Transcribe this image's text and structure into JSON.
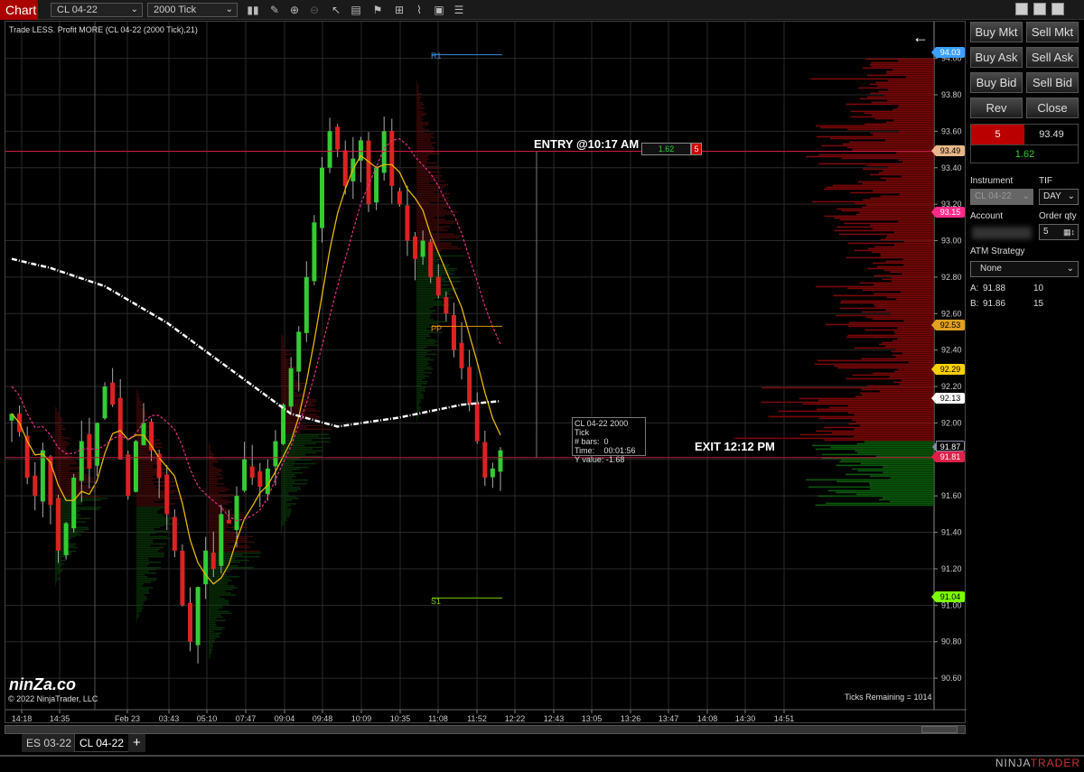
{
  "window": {
    "title": "Chart",
    "instrument": "CL 04-22",
    "interval": "2000 Tick"
  },
  "toolbar_icons": [
    "bar-type-icon",
    "draw-pencil-icon",
    "zoom-in-icon",
    "zoom-out-icon",
    "pointer-icon",
    "data-box-icon",
    "strategies-icon",
    "indicators-icon",
    "drawing-tools-icon",
    "templates-icon",
    "properties-icon"
  ],
  "chart": {
    "indicator_label": "Trade LESS. Profit MORE (CL 04-22 (2000 Tick),21)",
    "entry_label": "ENTRY @10:17 AM",
    "exit_label": "EXIT 12:12 PM",
    "position_pnl": "1.62",
    "position_qty": "5",
    "level_labels": {
      "r1": "R1",
      "pp": "PP",
      "s1": "S1"
    },
    "tooltip": {
      "line1": "CL 04-22 2000 Tick",
      "bars_label": "# bars:",
      "bars": "0",
      "time_label": "Time:",
      "time": "00:01:56",
      "y_label": "Y value:",
      "y": "-1.68"
    },
    "logo": "ninZa.co",
    "copyright": "© 2022 NinjaTrader, LLC",
    "ticks_remaining": "Ticks Remaining = 1014",
    "back_arrow": "←"
  },
  "chart_data": {
    "type": "candlestick",
    "instrument": "CL 04-22",
    "ylim": [
      90.5,
      94.1
    ],
    "y_ticks": [
      "94.00",
      "93.80",
      "93.60",
      "93.40",
      "93.20",
      "93.00",
      "92.80",
      "92.60",
      "92.40",
      "92.20",
      "92.00",
      "91.80",
      "91.60",
      "91.40",
      "91.20",
      "91.00",
      "90.80",
      "90.60"
    ],
    "x_ticks": [
      "14:18",
      "14:35",
      "Feb 23",
      "03:43",
      "05:10",
      "07:47",
      "09:04",
      "09:48",
      "10:09",
      "10:35",
      "11:08",
      "11:52",
      "12:22",
      "12:43",
      "13:05",
      "13:26",
      "13:47",
      "14:08",
      "14:30",
      "14:51"
    ],
    "closes": [
      92.05,
      91.95,
      91.7,
      91.6,
      91.85,
      91.55,
      91.3,
      91.45,
      91.7,
      91.9,
      91.75,
      92.0,
      92.2,
      92.1,
      91.8,
      91.6,
      91.9,
      92.0,
      91.85,
      91.7,
      91.5,
      91.3,
      91.0,
      90.8,
      91.1,
      91.3,
      91.2,
      91.5,
      91.45,
      91.6,
      91.8,
      91.7,
      91.65,
      91.75,
      91.9,
      92.1,
      92.3,
      92.5,
      92.8,
      93.1,
      93.4,
      93.6,
      93.5,
      93.3,
      93.45,
      93.55,
      93.2,
      93.4,
      93.6,
      93.3,
      93.2,
      93.0,
      92.9,
      93.0,
      92.8,
      92.7,
      92.6,
      92.4,
      92.3,
      92.1,
      91.9,
      91.7,
      91.75,
      91.85
    ],
    "ema_white": [
      [
        0,
        92.9
      ],
      [
        5,
        92.85
      ],
      [
        12,
        92.75
      ],
      [
        20,
        92.55
      ],
      [
        28,
        92.3
      ],
      [
        36,
        92.05
      ],
      [
        42,
        91.98
      ],
      [
        50,
        92.03
      ],
      [
        58,
        92.1
      ],
      [
        63,
        92.12
      ]
    ],
    "levels": {
      "entry": 93.49,
      "exit": 91.81,
      "r1": 94.02,
      "pp": 92.53,
      "s1": 91.04
    },
    "price_markers": [
      {
        "value": "94.03",
        "color": "#3aa0ff"
      },
      {
        "value": "93.49",
        "color": "#e8b88a"
      },
      {
        "value": "93.15",
        "color": "#ff2a8a"
      },
      {
        "value": "92.53",
        "color": "#e0a020"
      },
      {
        "value": "92.29",
        "color": "#ffd000"
      },
      {
        "value": "92.13",
        "color": "#ffffff"
      },
      {
        "value": "91.87",
        "color": "#000000"
      },
      {
        "value": "91.81",
        "color": "#e0204a"
      },
      {
        "value": "91.04",
        "color": "#7cff00"
      }
    ]
  },
  "tabs": [
    {
      "label": "ES 03-22"
    },
    {
      "label": "CL 04-22"
    },
    {
      "label": "+"
    }
  ],
  "panel": {
    "buttons": {
      "buy_mkt": "Buy Mkt",
      "sell_mkt": "Sell Mkt",
      "buy_ask": "Buy Ask",
      "sell_ask": "Sell Ask",
      "buy_bid": "Buy Bid",
      "sell_bid": "Sell Bid",
      "rev": "Rev",
      "close": "Close"
    },
    "position_qty": "5",
    "avg_price": "93.49",
    "unrealized": "1.62",
    "instrument_label": "Instrument",
    "instrument": "CL 04-22",
    "tif_label": "TIF",
    "tif": "DAY",
    "account_label": "Account",
    "order_qty_label": "Order qty",
    "order_qty": "5",
    "atm_label": "ATM Strategy",
    "atm": "None",
    "ask_label": "A:",
    "ask": "91.88",
    "ask_size": "10",
    "bid_label": "B:",
    "bid": "91.86",
    "bid_size": "15"
  },
  "brand": {
    "ninja": "NINJA",
    "trader": "TRADER"
  }
}
